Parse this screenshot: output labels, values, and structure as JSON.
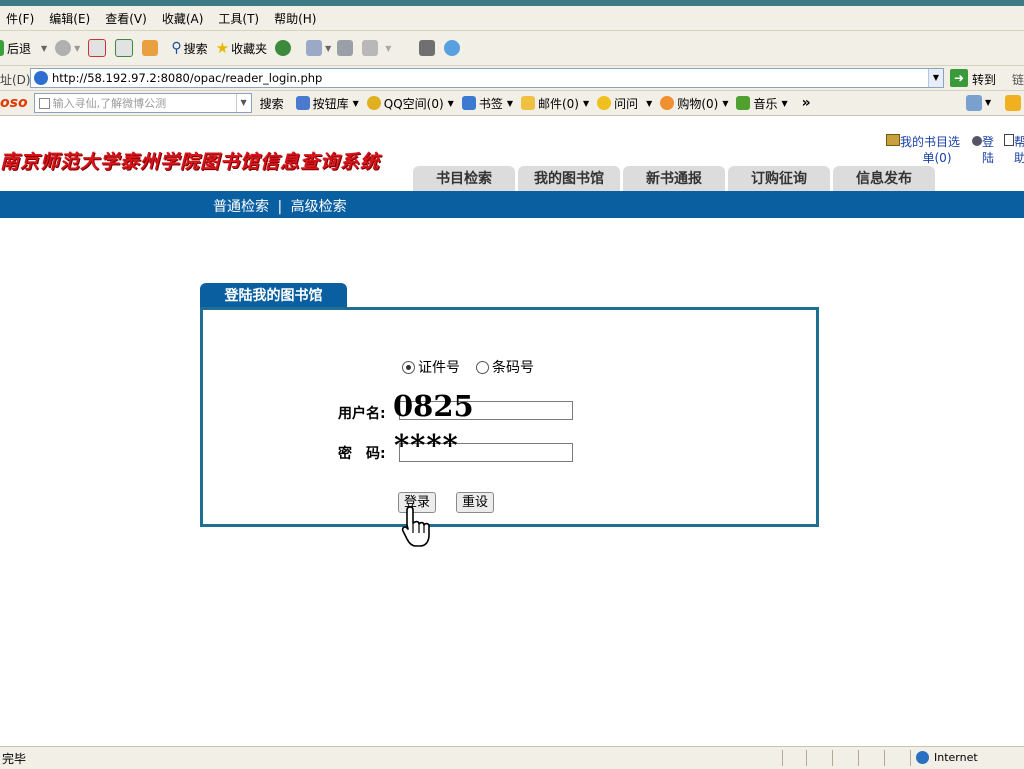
{
  "menu": [
    "件(F)",
    "编辑(E)",
    "查看(V)",
    "收藏(A)",
    "工具(T)",
    "帮助(H)"
  ],
  "toolbar": {
    "back": "后退",
    "search": "搜索",
    "favorites": "收藏夹"
  },
  "address": {
    "label": "址(D)",
    "url": "http://58.192.97.2:8080/opac/reader_login.php",
    "go": "转到",
    "links": "链"
  },
  "soso": {
    "logo": "oso",
    "placeholder": "输入寻仙,了解微博公测",
    "search": "搜索",
    "items": [
      "按钮库",
      "QQ空间(0)",
      "书签",
      "邮件(0)",
      "问问",
      "购物(0)",
      "音乐"
    ],
    "more": "»"
  },
  "site": {
    "title": "南京师范大学泰州学院图书馆信息查询系统",
    "booklist_line1": "我的书目选",
    "booklist_line2": "单(0)",
    "login_line1": "登",
    "login_line2": "陆",
    "help_line1": "帮",
    "help_line2": "助"
  },
  "nav": [
    "书目检索",
    "我的图书馆",
    "新书通报",
    "订购征询",
    "信息发布"
  ],
  "subnav": {
    "basic": "普通检索",
    "sep": "|",
    "advanced": "高级检索"
  },
  "login": {
    "tab": "登陆我的图书馆",
    "radio_id": "证件号",
    "radio_barcode": "条码号",
    "username_label": "用户名:",
    "username_value": "0825",
    "password_label": "密　码:",
    "password_value": "****",
    "submit": "登录",
    "reset": "重设"
  },
  "status": {
    "done": "完毕",
    "zone": "Internet"
  }
}
